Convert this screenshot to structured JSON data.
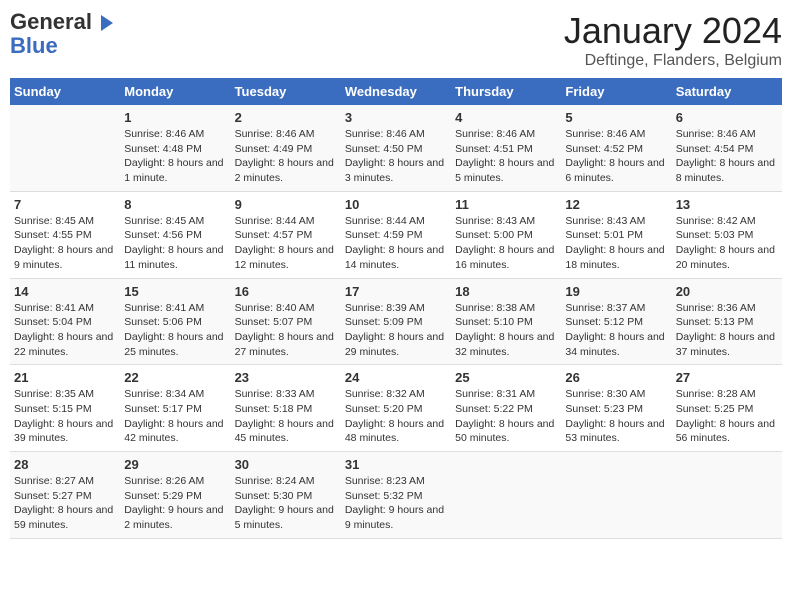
{
  "header": {
    "logo_line1": "General",
    "logo_line2": "Blue",
    "title": "January 2024",
    "subtitle": "Deftinge, Flanders, Belgium"
  },
  "days_of_week": [
    "Sunday",
    "Monday",
    "Tuesday",
    "Wednesday",
    "Thursday",
    "Friday",
    "Saturday"
  ],
  "weeks": [
    [
      {
        "num": "",
        "sunrise": "",
        "sunset": "",
        "daylight": ""
      },
      {
        "num": "1",
        "sunrise": "Sunrise: 8:46 AM",
        "sunset": "Sunset: 4:48 PM",
        "daylight": "Daylight: 8 hours and 1 minute."
      },
      {
        "num": "2",
        "sunrise": "Sunrise: 8:46 AM",
        "sunset": "Sunset: 4:49 PM",
        "daylight": "Daylight: 8 hours and 2 minutes."
      },
      {
        "num": "3",
        "sunrise": "Sunrise: 8:46 AM",
        "sunset": "Sunset: 4:50 PM",
        "daylight": "Daylight: 8 hours and 3 minutes."
      },
      {
        "num": "4",
        "sunrise": "Sunrise: 8:46 AM",
        "sunset": "Sunset: 4:51 PM",
        "daylight": "Daylight: 8 hours and 5 minutes."
      },
      {
        "num": "5",
        "sunrise": "Sunrise: 8:46 AM",
        "sunset": "Sunset: 4:52 PM",
        "daylight": "Daylight: 8 hours and 6 minutes."
      },
      {
        "num": "6",
        "sunrise": "Sunrise: 8:46 AM",
        "sunset": "Sunset: 4:54 PM",
        "daylight": "Daylight: 8 hours and 8 minutes."
      }
    ],
    [
      {
        "num": "7",
        "sunrise": "Sunrise: 8:45 AM",
        "sunset": "Sunset: 4:55 PM",
        "daylight": "Daylight: 8 hours and 9 minutes."
      },
      {
        "num": "8",
        "sunrise": "Sunrise: 8:45 AM",
        "sunset": "Sunset: 4:56 PM",
        "daylight": "Daylight: 8 hours and 11 minutes."
      },
      {
        "num": "9",
        "sunrise": "Sunrise: 8:44 AM",
        "sunset": "Sunset: 4:57 PM",
        "daylight": "Daylight: 8 hours and 12 minutes."
      },
      {
        "num": "10",
        "sunrise": "Sunrise: 8:44 AM",
        "sunset": "Sunset: 4:59 PM",
        "daylight": "Daylight: 8 hours and 14 minutes."
      },
      {
        "num": "11",
        "sunrise": "Sunrise: 8:43 AM",
        "sunset": "Sunset: 5:00 PM",
        "daylight": "Daylight: 8 hours and 16 minutes."
      },
      {
        "num": "12",
        "sunrise": "Sunrise: 8:43 AM",
        "sunset": "Sunset: 5:01 PM",
        "daylight": "Daylight: 8 hours and 18 minutes."
      },
      {
        "num": "13",
        "sunrise": "Sunrise: 8:42 AM",
        "sunset": "Sunset: 5:03 PM",
        "daylight": "Daylight: 8 hours and 20 minutes."
      }
    ],
    [
      {
        "num": "14",
        "sunrise": "Sunrise: 8:41 AM",
        "sunset": "Sunset: 5:04 PM",
        "daylight": "Daylight: 8 hours and 22 minutes."
      },
      {
        "num": "15",
        "sunrise": "Sunrise: 8:41 AM",
        "sunset": "Sunset: 5:06 PM",
        "daylight": "Daylight: 8 hours and 25 minutes."
      },
      {
        "num": "16",
        "sunrise": "Sunrise: 8:40 AM",
        "sunset": "Sunset: 5:07 PM",
        "daylight": "Daylight: 8 hours and 27 minutes."
      },
      {
        "num": "17",
        "sunrise": "Sunrise: 8:39 AM",
        "sunset": "Sunset: 5:09 PM",
        "daylight": "Daylight: 8 hours and 29 minutes."
      },
      {
        "num": "18",
        "sunrise": "Sunrise: 8:38 AM",
        "sunset": "Sunset: 5:10 PM",
        "daylight": "Daylight: 8 hours and 32 minutes."
      },
      {
        "num": "19",
        "sunrise": "Sunrise: 8:37 AM",
        "sunset": "Sunset: 5:12 PM",
        "daylight": "Daylight: 8 hours and 34 minutes."
      },
      {
        "num": "20",
        "sunrise": "Sunrise: 8:36 AM",
        "sunset": "Sunset: 5:13 PM",
        "daylight": "Daylight: 8 hours and 37 minutes."
      }
    ],
    [
      {
        "num": "21",
        "sunrise": "Sunrise: 8:35 AM",
        "sunset": "Sunset: 5:15 PM",
        "daylight": "Daylight: 8 hours and 39 minutes."
      },
      {
        "num": "22",
        "sunrise": "Sunrise: 8:34 AM",
        "sunset": "Sunset: 5:17 PM",
        "daylight": "Daylight: 8 hours and 42 minutes."
      },
      {
        "num": "23",
        "sunrise": "Sunrise: 8:33 AM",
        "sunset": "Sunset: 5:18 PM",
        "daylight": "Daylight: 8 hours and 45 minutes."
      },
      {
        "num": "24",
        "sunrise": "Sunrise: 8:32 AM",
        "sunset": "Sunset: 5:20 PM",
        "daylight": "Daylight: 8 hours and 48 minutes."
      },
      {
        "num": "25",
        "sunrise": "Sunrise: 8:31 AM",
        "sunset": "Sunset: 5:22 PM",
        "daylight": "Daylight: 8 hours and 50 minutes."
      },
      {
        "num": "26",
        "sunrise": "Sunrise: 8:30 AM",
        "sunset": "Sunset: 5:23 PM",
        "daylight": "Daylight: 8 hours and 53 minutes."
      },
      {
        "num": "27",
        "sunrise": "Sunrise: 8:28 AM",
        "sunset": "Sunset: 5:25 PM",
        "daylight": "Daylight: 8 hours and 56 minutes."
      }
    ],
    [
      {
        "num": "28",
        "sunrise": "Sunrise: 8:27 AM",
        "sunset": "Sunset: 5:27 PM",
        "daylight": "Daylight: 8 hours and 59 minutes."
      },
      {
        "num": "29",
        "sunrise": "Sunrise: 8:26 AM",
        "sunset": "Sunset: 5:29 PM",
        "daylight": "Daylight: 9 hours and 2 minutes."
      },
      {
        "num": "30",
        "sunrise": "Sunrise: 8:24 AM",
        "sunset": "Sunset: 5:30 PM",
        "daylight": "Daylight: 9 hours and 5 minutes."
      },
      {
        "num": "31",
        "sunrise": "Sunrise: 8:23 AM",
        "sunset": "Sunset: 5:32 PM",
        "daylight": "Daylight: 9 hours and 9 minutes."
      },
      {
        "num": "",
        "sunrise": "",
        "sunset": "",
        "daylight": ""
      },
      {
        "num": "",
        "sunrise": "",
        "sunset": "",
        "daylight": ""
      },
      {
        "num": "",
        "sunrise": "",
        "sunset": "",
        "daylight": ""
      }
    ]
  ]
}
